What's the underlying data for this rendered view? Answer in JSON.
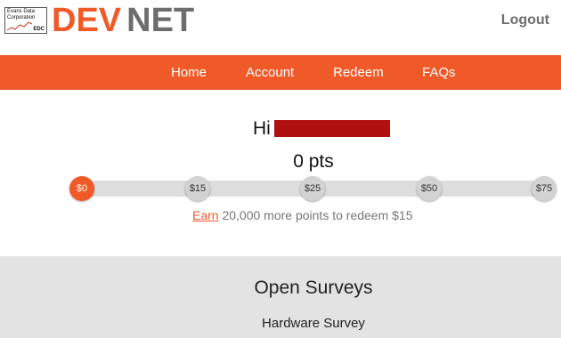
{
  "logo": {
    "line1": "Evans Data",
    "line2": "Corporation",
    "tag": "EDC"
  },
  "brand": {
    "part1": "DEV",
    "part2": "NET",
    "accent_color": "#f05a28",
    "secondary_color": "#6d6d6d"
  },
  "header": {
    "logout_label": "Logout"
  },
  "nav": {
    "items": [
      {
        "label": "Home"
      },
      {
        "label": "Account"
      },
      {
        "label": "Redeem"
      },
      {
        "label": "FAQs"
      }
    ]
  },
  "greeting": {
    "hi": "Hi"
  },
  "points": {
    "display": "0 pts",
    "value": 0
  },
  "progress": {
    "current_value": 0,
    "milestones": [
      {
        "label": "$0",
        "active": true
      },
      {
        "label": "$15",
        "active": false
      },
      {
        "label": "$25",
        "active": false
      },
      {
        "label": "$50",
        "active": false
      },
      {
        "label": "$75",
        "active": false
      }
    ]
  },
  "earn": {
    "link_label": "Earn",
    "message": " 20,000 more points to redeem $15"
  },
  "surveys": {
    "title": "Open Surveys",
    "items": [
      {
        "label": "Hardware Survey"
      }
    ]
  }
}
